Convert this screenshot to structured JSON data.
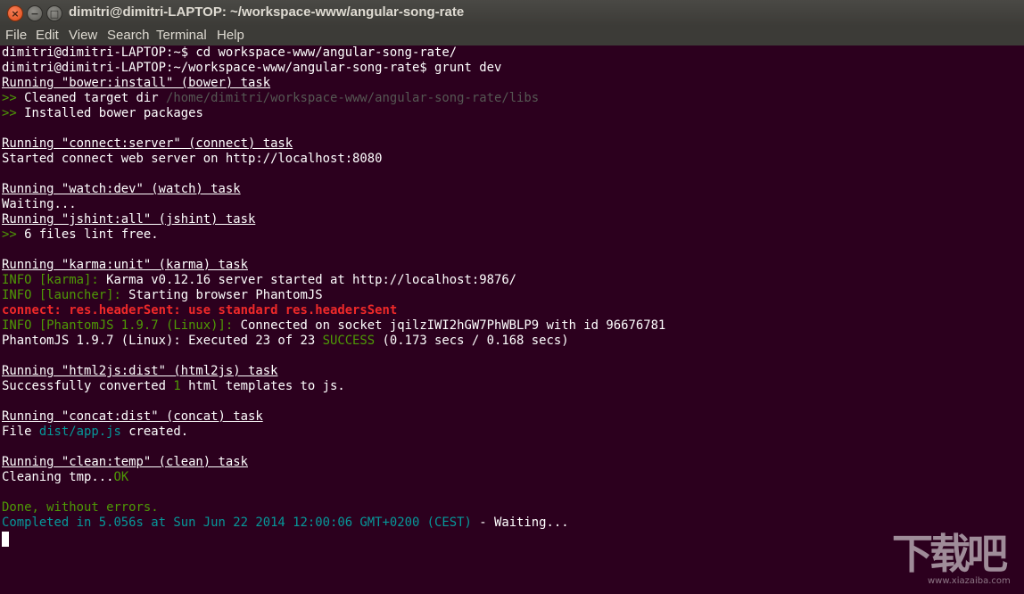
{
  "window": {
    "title": "dimitri@dimitri-LAPTOP: ~/workspace-www/angular-song-rate",
    "buttons": {
      "close": "×",
      "minimize": "−",
      "maximize": "□"
    }
  },
  "menu": [
    "File",
    "Edit",
    "View",
    "Search",
    "Terminal",
    "Help"
  ],
  "terminal": {
    "l0": "dimitri@dimitri-LAPTOP:~$ cd workspace-www/angular-song-rate/",
    "l1": "dimitri@dimitri-LAPTOP:~/workspace-www/angular-song-rate$ grunt dev",
    "l2": "Running \"bower:install\" (bower) task",
    "l3a": ">>",
    "l3b": " Cleaned target dir ",
    "l3c": "/home/dimitri/workspace-www/angular-song-rate/libs",
    "l4a": ">>",
    "l4b": " Installed bower packages",
    "l6": "Running \"connect:server\" (connect) task",
    "l7": "Started connect web server on http://localhost:8080",
    "l9": "Running \"watch:dev\" (watch) task",
    "l10": "Waiting...",
    "l11": "Running \"jshint:all\" (jshint) task",
    "l12a": ">>",
    "l12b": " 6 files lint free.",
    "l14": "Running \"karma:unit\" (karma) task",
    "l15a": "INFO [karma]:",
    "l15b": " Karma v0.12.16 server started at http://localhost:9876/",
    "l16a": "INFO [launcher]:",
    "l16b": " Starting browser PhantomJS",
    "l17": "connect: res.headerSent: use standard res.headersSent",
    "l18a": "INFO [PhantomJS 1.9.7 (Linux)]:",
    "l18b": " Connected on socket jqilzIWI2hGW7PhWBLP9 with id 96676781",
    "l19a": "PhantomJS 1.9.7 (Linux): Executed 23 of 23 ",
    "l19b": "SUCCESS",
    "l19c": " (0.173 secs / 0.168 secs)",
    "l21": "Running \"html2js:dist\" (html2js) task",
    "l22a": "Successfully converted ",
    "l22b": "1",
    "l22c": " html templates to js.",
    "l24": "Running \"concat:dist\" (concat) task",
    "l25a": "File ",
    "l25b": "dist/app.js",
    "l25c": " created.",
    "l27": "Running \"clean:temp\" (clean) task",
    "l28a": "Cleaning tmp...",
    "l28b": "OK",
    "l30": "Done, without errors.",
    "l31a": "Completed in 5.056s at Sun Jun 22 2014 12:00:06 GMT+0200 (CEST)",
    "l31b": " - Waiting..."
  },
  "watermark": {
    "glyphs": "下载吧",
    "url": "www.xiazaiba.com"
  },
  "colors": {
    "background": "#2c001e",
    "text": "#ffffff",
    "green": "#4e9a06",
    "cyan": "#06989a",
    "red": "#ef2929",
    "grey": "#555753"
  }
}
